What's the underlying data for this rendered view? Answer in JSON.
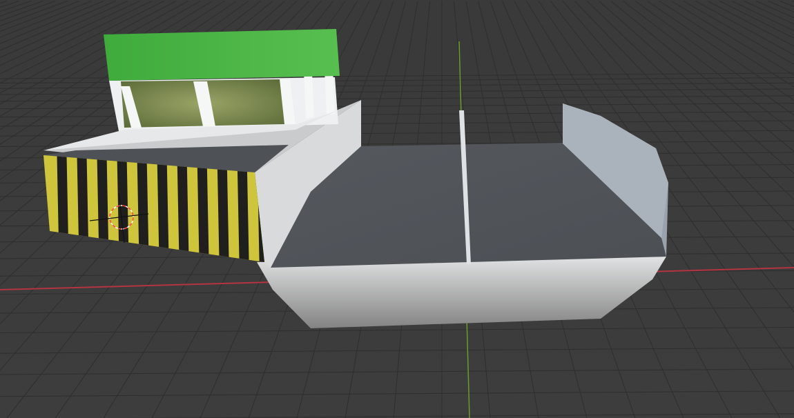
{
  "app": {
    "editor": "3D Viewport",
    "hud_text": ""
  },
  "colors": {
    "background": "#3b3b3b",
    "grid_line": "#2e2e2e",
    "axis_x": "#b43440",
    "axis_y": "#6d9a2f",
    "cabin_roof": "#4fb848",
    "cabin_white": "#f2f4f5",
    "deck": "#565b60",
    "hull_light": "#d9dadb",
    "hull_dark": "#8f8f8f",
    "stripe_yellow": "#cfc53a",
    "stripe_dark": "#1f1f1f",
    "window_glass": "#7b8a45",
    "cursor_red": "#ff4545",
    "cursor_white": "#ffffff"
  },
  "objects": {
    "boat": "boat-model",
    "cabin": "cabin",
    "stripes": "hazard-stripes",
    "cursor": "3d-cursor"
  }
}
